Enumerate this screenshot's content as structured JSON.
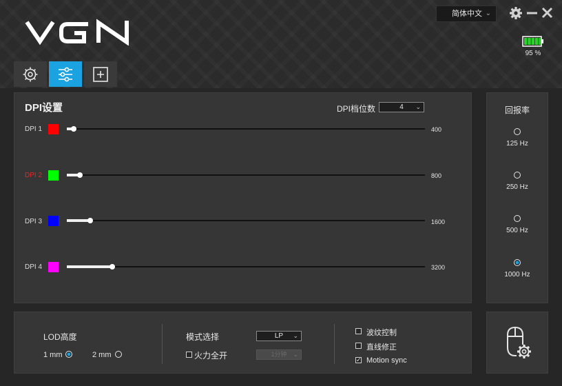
{
  "app": {
    "logo_text": "VGN"
  },
  "header": {
    "language": "简体中文",
    "battery_percent": "95 %",
    "window_buttons": [
      "gear-icon",
      "minimize-icon",
      "close-icon"
    ]
  },
  "tabs": [
    {
      "name": "settings",
      "icon": "gear-icon",
      "active": false
    },
    {
      "name": "dpi",
      "icon": "sliders-icon",
      "active": true
    },
    {
      "name": "macro",
      "icon": "plus-square-icon",
      "active": false
    }
  ],
  "dpi": {
    "title": "DPI设置",
    "level_label": "DPI档位数",
    "level_value": "4",
    "rows": [
      {
        "label": "DPI 1",
        "color": "#ff0000",
        "value": "400",
        "fill_fraction": 0.02,
        "active": false
      },
      {
        "label": "DPI 2",
        "color": "#00ff00",
        "value": "800",
        "fill_fraction": 0.036,
        "active": true
      },
      {
        "label": "DPI 3",
        "color": "#0000ff",
        "value": "1600",
        "fill_fraction": 0.066,
        "active": false
      },
      {
        "label": "DPI 4",
        "color": "#ff00ff",
        "value": "3200",
        "fill_fraction": 0.127,
        "active": false
      }
    ]
  },
  "polling": {
    "title": "回报率",
    "options": [
      {
        "label": "125 Hz",
        "checked": false
      },
      {
        "label": "250 Hz",
        "checked": false
      },
      {
        "label": "500 Hz",
        "checked": false
      },
      {
        "label": "1000 Hz",
        "checked": true
      }
    ]
  },
  "lod": {
    "title": "LOD高度",
    "options": [
      {
        "label": "1 mm",
        "checked": true
      },
      {
        "label": "2 mm",
        "checked": false
      }
    ]
  },
  "mode": {
    "title": "模式选择",
    "mode_value": "LP",
    "fire_label": "火力全开",
    "fire_checked": false,
    "fire_value": "1分钟"
  },
  "toggles": [
    {
      "label": "波纹控制",
      "checked": false
    },
    {
      "label": "直线修正",
      "checked": false
    },
    {
      "label": "Motion sync",
      "checked": true
    }
  ],
  "colors": {
    "accent": "#1aa3e0",
    "panel": "#363636",
    "background": "#262626"
  },
  "mouse_settings_icon": "mouse-gear-icon"
}
